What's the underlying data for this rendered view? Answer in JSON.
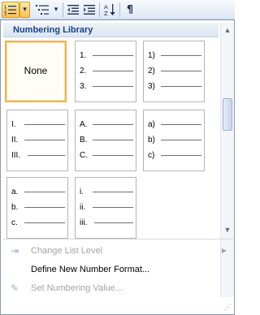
{
  "toolbar": {
    "numbering_icon": "numbering-list-icon",
    "multilevel_icon": "multilevel-list-icon",
    "dropdown_arrow": "▾",
    "decrease_indent": "decrease-indent-icon",
    "increase_indent": "increase-indent-icon",
    "sort_icon": "sort-icon",
    "show_marks_glyph": "¶"
  },
  "library": {
    "header": "Numbering Library",
    "tiles": [
      {
        "kind": "none",
        "label": "None",
        "selected": true
      },
      {
        "kind": "list",
        "markers": [
          "1.",
          "2.",
          "3."
        ]
      },
      {
        "kind": "list",
        "markers": [
          "1)",
          "2)",
          "3)"
        ]
      },
      {
        "kind": "list",
        "markers": [
          "I.",
          "II.",
          "III."
        ]
      },
      {
        "kind": "list",
        "markers": [
          "A.",
          "B.",
          "C."
        ]
      },
      {
        "kind": "list",
        "markers": [
          "a)",
          "b)",
          "c)"
        ]
      },
      {
        "kind": "list",
        "markers": [
          "a.",
          "b.",
          "c."
        ]
      },
      {
        "kind": "list",
        "markers": [
          "i.",
          "ii.",
          "iii."
        ]
      }
    ]
  },
  "menu": {
    "change_level": "Change List Level",
    "define_format": "Define New Number Format...",
    "set_value": "Set Numbering Value..."
  },
  "colors": {
    "accent_header": "#15428b",
    "selected_border": "#f2b04a",
    "disabled_text": "#a3a3a3"
  }
}
